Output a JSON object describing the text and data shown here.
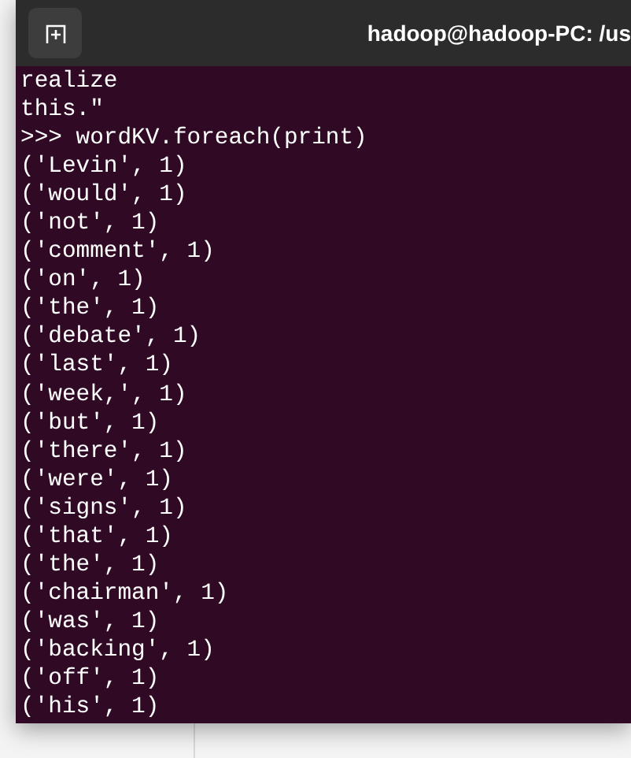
{
  "window": {
    "title": "hadoop@hadoop-PC: /us"
  },
  "terminal": {
    "lines": [
      "realize",
      "this.\"",
      ">>> wordKV.foreach(print)",
      "('Levin', 1)",
      "('would', 1)",
      "('not', 1)",
      "('comment', 1)",
      "('on', 1)",
      "('the', 1)",
      "('debate', 1)",
      "('last', 1)",
      "('week,', 1)",
      "('but', 1)",
      "('there', 1)",
      "('were', 1)",
      "('signs', 1)",
      "('that', 1)",
      "('the', 1)",
      "('chairman', 1)",
      "('was', 1)",
      "('backing', 1)",
      "('off', 1)",
      "('his', 1)"
    ]
  }
}
